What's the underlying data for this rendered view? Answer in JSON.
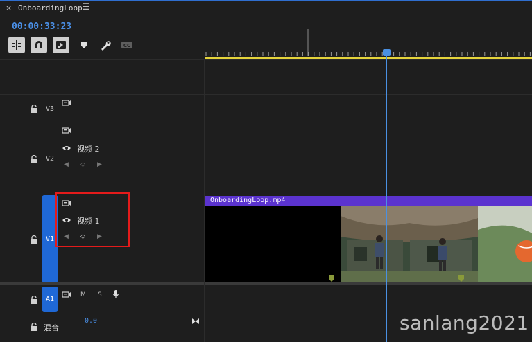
{
  "tab": {
    "title": "OnboardingLoop"
  },
  "timecode": "00:00:33:23",
  "tracks": {
    "v3": {
      "name": "V3"
    },
    "v2": {
      "name": "V2",
      "label": "视频 2"
    },
    "v1": {
      "name": "V1",
      "label": "视频 1"
    },
    "a1": {
      "name": "A1",
      "mute": "M",
      "solo": "S"
    },
    "mix": {
      "label": "混合",
      "value": "0.0"
    }
  },
  "clip": {
    "name": "OnboardingLoop.mp4"
  },
  "watermark": "sanlang2021",
  "colors": {
    "accent": "#1f68d6",
    "playhead": "#4a90e2",
    "clip_header": "#5b33cf",
    "highlight": "#e41b1b",
    "work_area": "#e4d33b"
  }
}
